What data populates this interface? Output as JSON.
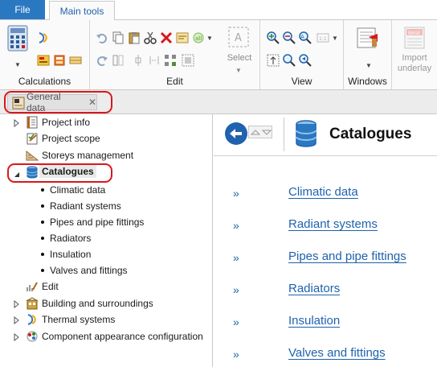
{
  "ribbon": {
    "tabs": {
      "file": "File",
      "main": "Main tools"
    },
    "groups": {
      "calculations": "Calculations",
      "edit": "Edit",
      "view": "View",
      "windows": "Windows",
      "import_underlay": "Import underlay",
      "select": "Select"
    }
  },
  "doc_tab": {
    "label": "General data",
    "close": "✕"
  },
  "tree": {
    "items": [
      {
        "label": "Project info"
      },
      {
        "label": "Project scope"
      },
      {
        "label": "Storeys management"
      },
      {
        "label": "Catalogues"
      },
      {
        "label": "Climatic data"
      },
      {
        "label": "Radiant systems"
      },
      {
        "label": "Pipes and pipe fittings"
      },
      {
        "label": "Radiators"
      },
      {
        "label": "Insulation"
      },
      {
        "label": "Valves and fittings"
      },
      {
        "label": "Edit"
      },
      {
        "label": "Building and surroundings"
      },
      {
        "label": "Thermal systems"
      },
      {
        "label": "Component appearance configuration"
      }
    ]
  },
  "panel": {
    "title": "Catalogues",
    "links": [
      {
        "chevron": "»",
        "label": "Climatic data"
      },
      {
        "chevron": "»",
        "label": "Radiant systems"
      },
      {
        "chevron": "»",
        "label": "Pipes and pipe fittings"
      },
      {
        "chevron": "»",
        "label": "Radiators"
      },
      {
        "chevron": "»",
        "label": "Insulation"
      },
      {
        "chevron": "»",
        "label": "Valves and fittings"
      }
    ]
  },
  "colors": {
    "accent": "#2b78c2",
    "link": "#1f62ad",
    "highlight": "#d7191c"
  }
}
